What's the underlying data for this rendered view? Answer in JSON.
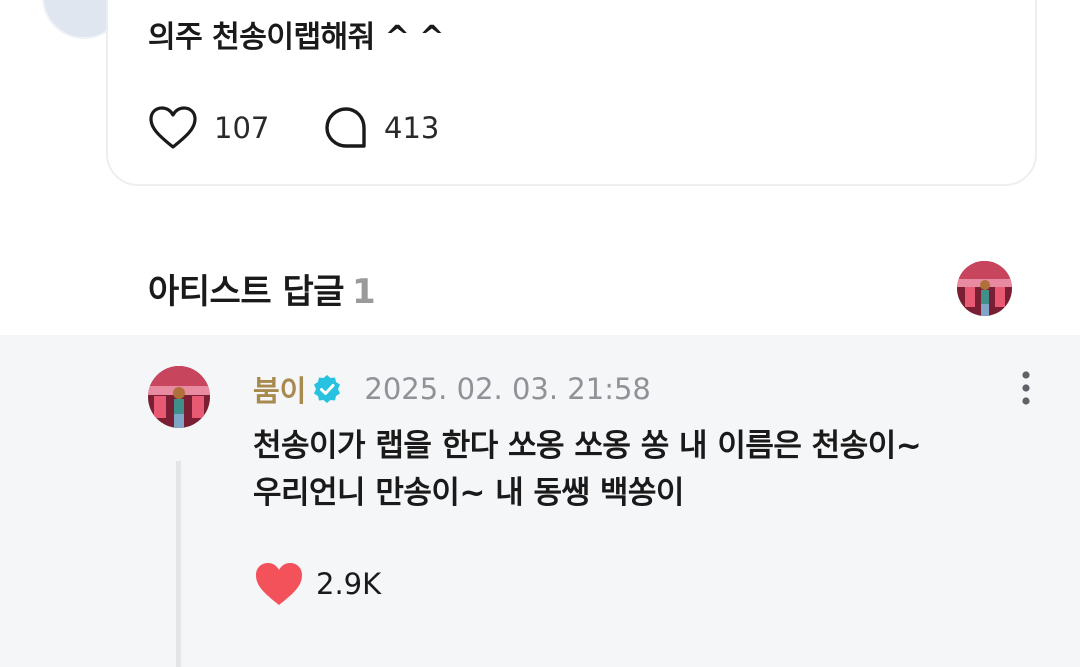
{
  "post": {
    "text": "의주 천송이랩해줘 ^ ^",
    "like_icon": "heart-outline-icon",
    "like_count": "107",
    "comment_icon": "speech-bubble-icon",
    "comment_count": "413"
  },
  "artist_replies": {
    "title": "아티스트 답글",
    "count": "1"
  },
  "reply": {
    "author": "붐이",
    "verified_icon": "verified-badge-icon",
    "timestamp": "2025. 02. 03. 21:58",
    "lines": [
      "천송이가 랩을 한다 쏘옹 쏘옹 쏭 내 이름은 천송이~",
      "우리언니 만송이~ 내 동쌩 백쏭이"
    ],
    "like_icon": "heart-filled-icon",
    "like_count": "2.9K"
  },
  "colors": {
    "author": "#a88a4f",
    "verified": "#27c2e0",
    "heart_filled": "#f4525a",
    "reply_background": "#f5f6f8"
  }
}
